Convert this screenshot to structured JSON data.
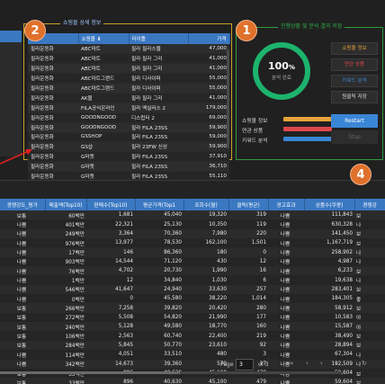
{
  "detail_panel": {
    "title": "쇼핑몰 상세 정보",
    "columns": [
      "순",
      "쇼핑몰 ⬇",
      "타이틀",
      "가격"
    ],
    "rows": [
      [
        "필라운동화",
        "ABC마트",
        "필라 필라스웹",
        "47,000"
      ],
      [
        "필라운동화",
        "ABC마트",
        "필라 필라 그리",
        "41,000"
      ],
      [
        "필라운동화",
        "ABC마트",
        "필라 필라 그리",
        "41,000"
      ],
      [
        "필라운동화",
        "ABC마트그랜드",
        "필라 디사이퍼",
        "55,000"
      ],
      [
        "필라운동화",
        "ABC마트그랜드",
        "필라 디사이퍼",
        "55,000"
      ],
      [
        "필라운동화",
        "AK몰",
        "필라 필라 그리",
        "41,000"
      ],
      [
        "필라운동화",
        "FILA공식온라인",
        "필라 엑실러스 2",
        "179,000"
      ],
      [
        "필라운동화",
        "GOODNGOOD",
        "디스럽터 2",
        "69,000"
      ],
      [
        "필라운동화",
        "GOODNGOOD",
        "필라 FILA 23SS",
        "59,900"
      ],
      [
        "필라운동화",
        "GSSHOP",
        "필라 FILA 23SS",
        "59,000"
      ],
      [
        "필라운동화",
        "GS샵",
        "필라 23FW 신상",
        "59,900"
      ],
      [
        "필라운동화",
        "G마켓",
        "필라 FILA 23SS",
        "37,910"
      ],
      [
        "필라운동화",
        "G마켓",
        "필라 FILA 23SS",
        "36,710"
      ],
      [
        "필라운동화",
        "G마켓",
        "필라 FILA 23SS",
        "55,110"
      ]
    ]
  },
  "progress_panel": {
    "title": "진행상황 및 분석 결과 저장",
    "percent": "100",
    "percent_unit": "%",
    "status_label": "분석 완료",
    "bars": [
      {
        "label": "쇼핑몰 정보",
        "color": "#e8a33a"
      },
      {
        "label": "연관 상품",
        "color": "#e0474c"
      },
      {
        "label": "키워드 분석",
        "color": "#3a86d6"
      }
    ],
    "buttons": [
      {
        "label": "쇼핑몰 정보",
        "color": "#e8a33a"
      },
      {
        "label": "연관 상품",
        "color": "#e0474c"
      },
      {
        "label": "키워드 분석",
        "color": "#3a86d6"
      },
      {
        "label": "원클릭 저장",
        "color": "#dddddd"
      }
    ],
    "restart_label": "Restart",
    "stop_label": "Stop"
  },
  "badges": {
    "one": "1",
    "two": "2",
    "four": "4"
  },
  "grid": {
    "columns": [
      "경쟁강도_평가",
      "매출액(Top10)",
      "판매수(Top10)",
      "평균가격(Top1",
      "조회수(월)",
      "클릭(평균)",
      "광고효과",
      "상품수(쿠팡)",
      "경쟁강"
    ],
    "rows": [
      [
        "보통",
        "60백만",
        "1,681",
        "45,040",
        "19,320",
        "319",
        "나쁨",
        "111,843",
        "보"
      ],
      [
        "나쁨",
        "401백만",
        "22,321",
        "25,130",
        "10,350",
        "119",
        "나쁨",
        "630,328",
        "나"
      ],
      [
        "나쁨",
        "249백만",
        "3,364",
        "70,360",
        "7,980",
        "220",
        "나쁨",
        "141,450",
        "보"
      ],
      [
        "나쁨",
        "976백만",
        "13,977",
        "78,530",
        "162,100",
        "1,501",
        "나쁨",
        "1,167,719",
        "보"
      ],
      [
        "나쁨",
        "17백만",
        "146",
        "86,360",
        "180",
        "0",
        "나쁨",
        "258,902",
        "나"
      ],
      [
        "나쁨",
        "903백만",
        "14,544",
        "71,120",
        "430",
        "12",
        "나쁨",
        "4,987",
        "나"
      ],
      [
        "나쁨",
        "76백만",
        "4,702",
        "20,730",
        "1,990",
        "16",
        "나쁨",
        "6,233",
        "보"
      ],
      [
        "나쁨",
        "1백만",
        "12",
        "34,840",
        "1,030",
        "6",
        "나쁨",
        "19,638",
        "나"
      ],
      [
        "나쁨",
        "546백만",
        "41,647",
        "24,940",
        "33,630",
        "257",
        "나쁨",
        "283,401",
        "보"
      ],
      [
        "나쁨",
        "0백만",
        "0",
        "45,580",
        "38,220",
        "1,014",
        "나쁨",
        "184,305",
        "좋"
      ],
      [
        "보통",
        "266백만",
        "7,258",
        "39,820",
        "20,420",
        "280",
        "나쁨",
        "58,912",
        "보"
      ],
      [
        "보통",
        "272백만",
        "5,508",
        "54,820",
        "21,990",
        "177",
        "나쁨",
        "10,583",
        "아"
      ],
      [
        "보통",
        "240백만",
        "5,128",
        "49,580",
        "18,770",
        "160",
        "나쁨",
        "15,587",
        "아"
      ],
      [
        "보통",
        "106백만",
        "2,563",
        "60,740",
        "22,400",
        "219",
        "나쁨",
        "38,490",
        "보"
      ],
      [
        "보통",
        "284백만",
        "5,845",
        "50,770",
        "23,610",
        "92",
        "나쁨",
        "28,894",
        "보"
      ],
      [
        "나쁨",
        "114백만",
        "4,051",
        "33,510",
        "480",
        "3",
        "나쁨",
        "67,304",
        "나"
      ],
      [
        "나쁨",
        "342백만",
        "14,673",
        "39,360",
        "570",
        "17",
        "나쁨",
        "192,509",
        "나"
      ],
      [
        "보통",
        "33백만",
        "896",
        "40,630",
        "45,100",
        "479",
        "나쁨",
        "59,604",
        "보"
      ],
      [
        "보통",
        "33백만",
        "896",
        "40,630",
        "45,100",
        "479",
        "나쁨",
        "59,604",
        "보"
      ]
    ]
  },
  "pager": {
    "page_label": "Page",
    "page_value": "3",
    "of_label": "of 3",
    "nav_first": "«",
    "nav_prev": "‹",
    "nav_next": "›",
    "nav_last": "»",
    "refresh_icon": "↻"
  },
  "colors": {
    "accent_blue": "#3a78c2",
    "badge_orange": "#e0712b",
    "ring_green": "#1db36d",
    "detail_border": "#c9a227",
    "progress_border": "#2f9a3c"
  }
}
